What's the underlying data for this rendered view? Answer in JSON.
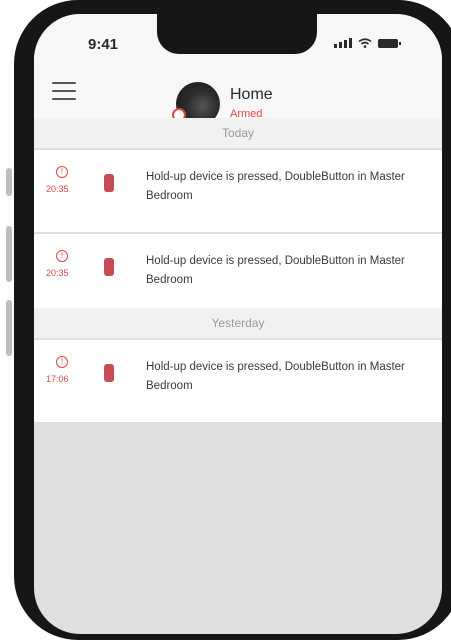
{
  "status_bar": {
    "time": "9:41"
  },
  "header": {
    "hub_name": "Home",
    "hub_status": "Armed"
  },
  "sections": [
    {
      "label": "Today",
      "events": [
        {
          "time": "20:35",
          "text": "Hold-up device is pressed, DoubleButton in Master Bedroom"
        },
        {
          "time": "20:35",
          "text": "Hold-up device is pressed, DoubleButton in Master Bedroom"
        }
      ]
    },
    {
      "label": "Yesterday",
      "events": [
        {
          "time": "17:06",
          "text": "Hold-up device is pressed, DoubleButton in Master Bedroom"
        }
      ]
    }
  ],
  "colors": {
    "alarm_red": "#e04848",
    "device_red": "#c94b55",
    "empty_area": "#dfdfdf"
  },
  "icons": {
    "menu": "hamburger-icon",
    "event": "alert-circle-icon",
    "device": "double-button-icon"
  }
}
